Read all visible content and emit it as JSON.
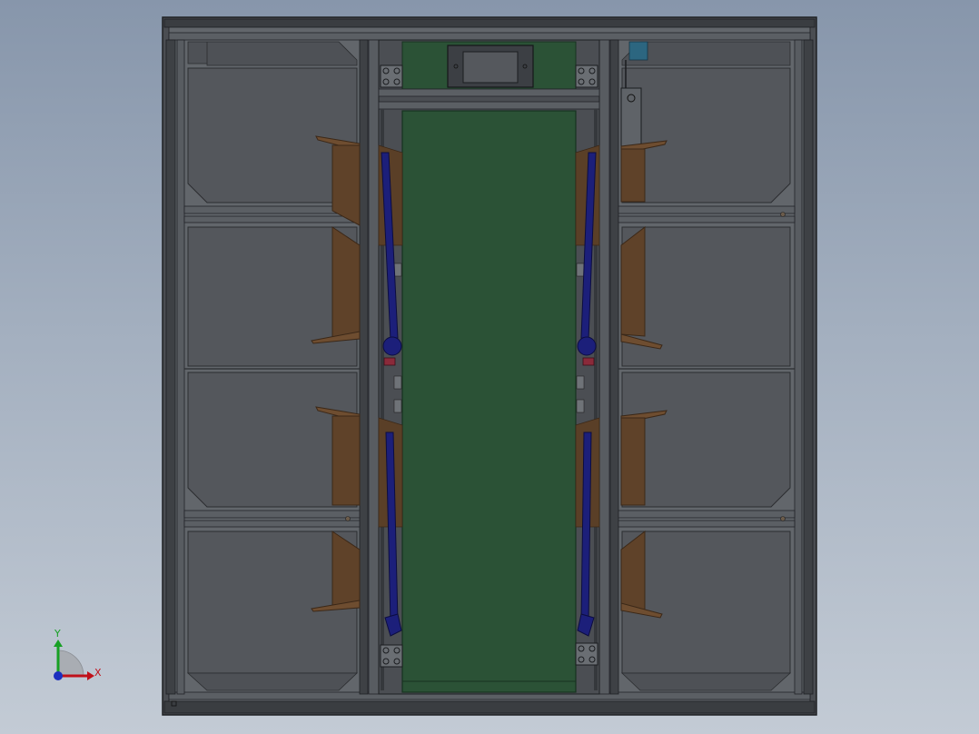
{
  "viewport": {
    "background_top": "#8796ab",
    "background_bottom": "#c3cbd5"
  },
  "model": {
    "colors": {
      "frame": "#5d6166",
      "frame_dark": "#2c2f33",
      "frame_light": "#777c82",
      "bin_fill": "#54575c",
      "bin_edge": "#2b2d30",
      "belt": "#2b5236",
      "belt_edge": "#173220",
      "flap": "#6e4d30",
      "flap_edge": "#3b2818",
      "arm": "#1c1f7a",
      "arm_edge": "#0c0d40",
      "display_bezel": "#3c3f44",
      "display_screen": "#55585d",
      "accent_teal": "#2c6680"
    },
    "left_bin_count": 4,
    "right_bin_count": 4,
    "diverter_arm_count": 4
  },
  "triad": {
    "x_label": "X",
    "y_label": "Y",
    "x_color": "#c0101a",
    "y_color": "#17a024",
    "z_color": "#1b2fbf"
  }
}
